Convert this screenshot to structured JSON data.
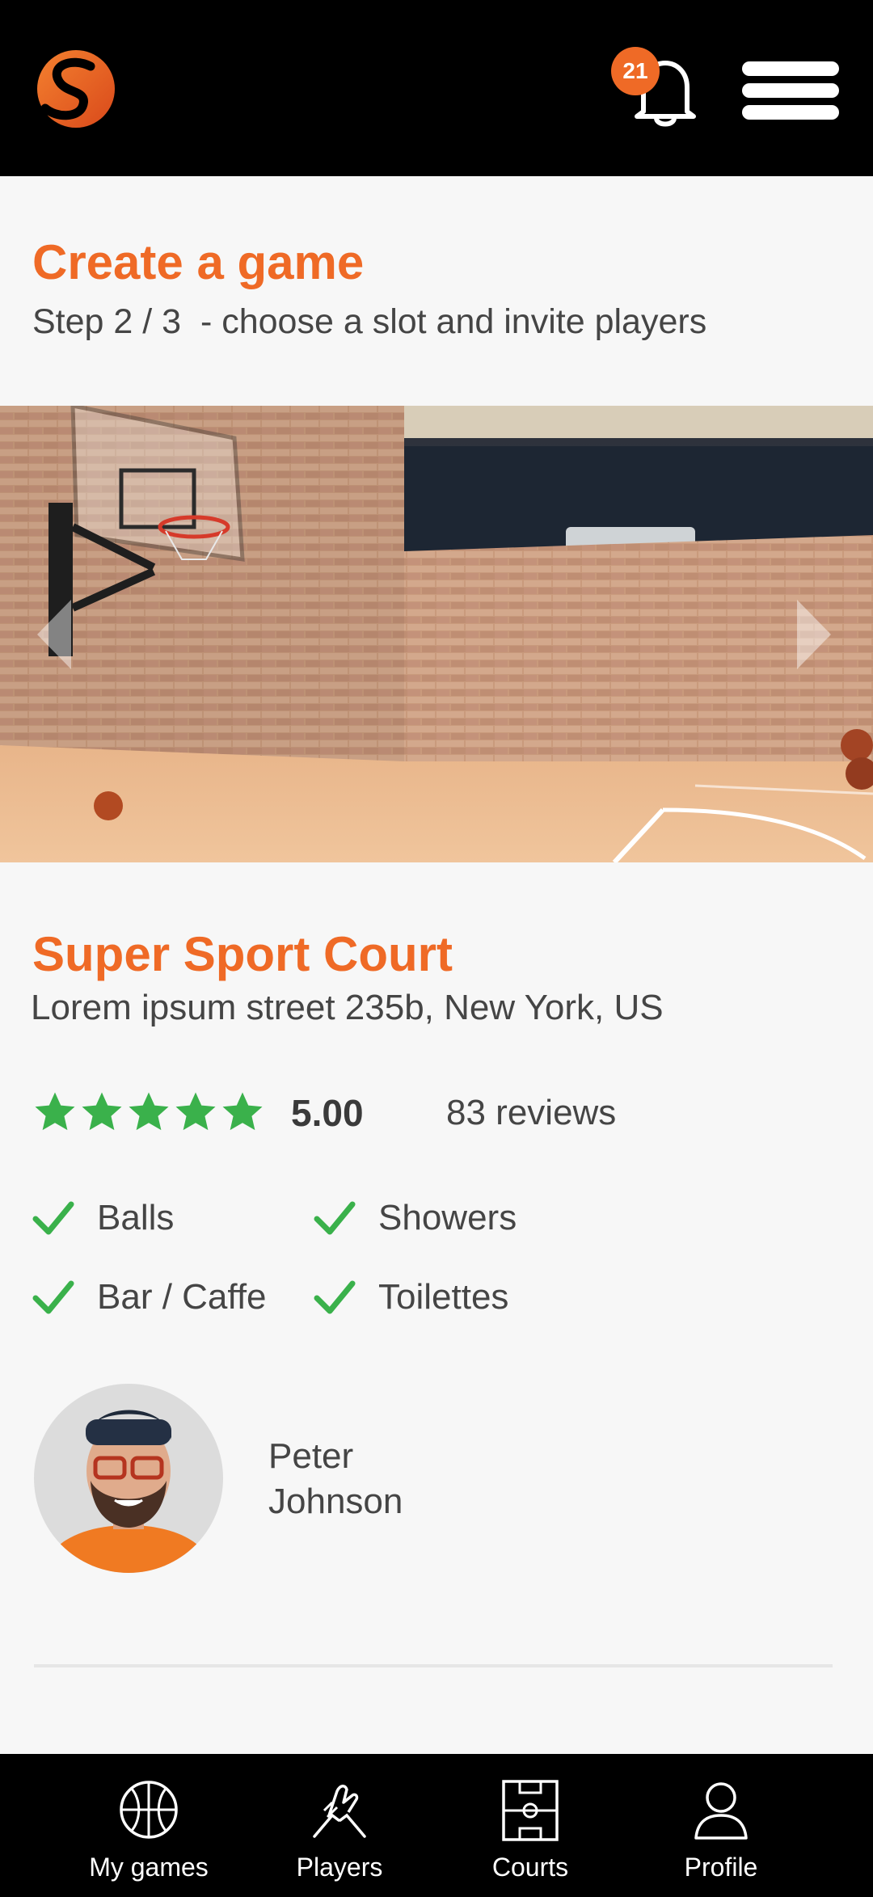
{
  "header": {
    "logo_letter": "S",
    "notifications_count": "21"
  },
  "page": {
    "title": "Create a game",
    "subtitle": "Step 2 / 3  - choose a slot and invite players"
  },
  "court": {
    "name": "Super Sport Court",
    "address": "Lorem ipsum street  235b, New York, US",
    "rating": "5.00",
    "stars": 5,
    "reviews": "83 reviews",
    "amenities": [
      "Balls",
      "Showers",
      "Bar / Caffe",
      "Toilettes"
    ]
  },
  "host": {
    "first_name": "Peter",
    "last_name": "Johnson"
  },
  "nav": {
    "items": [
      {
        "label": "My games",
        "icon": "basketball-icon"
      },
      {
        "label": "Players",
        "icon": "handshake-icon"
      },
      {
        "label": "Courts",
        "icon": "court-icon"
      },
      {
        "label": "Profile",
        "icon": "user-icon"
      }
    ]
  },
  "colors": {
    "accent": "#ef6a26",
    "check": "#3ab14b",
    "bar": "#000000",
    "background": "#f7f7f7"
  }
}
